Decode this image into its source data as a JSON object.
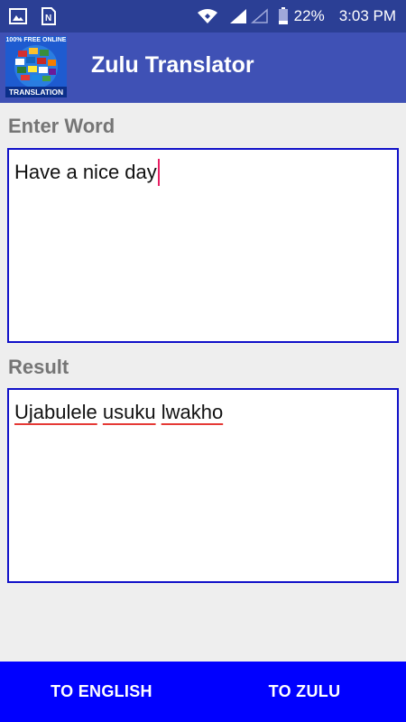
{
  "status_bar": {
    "left_icons": [
      "image-icon",
      "sim-card-icon"
    ],
    "right_icons": [
      "wifi-icon",
      "signal-icon",
      "signal-empty-icon",
      "battery-icon"
    ],
    "battery_percent": "22%",
    "time": "3:03 PM"
  },
  "app_bar": {
    "logo_top_text": "100% FREE ONLINE",
    "logo_bottom_text": "TRANSLATION",
    "title": "Zulu Translator"
  },
  "input_section": {
    "label": "Enter Word",
    "value": "Have a nice day"
  },
  "result_section": {
    "label": "Result",
    "words": [
      "Ujabulele",
      "usuku",
      "lwakho"
    ]
  },
  "bottom_bar": {
    "to_english_label": "TO ENGLISH",
    "to_zulu_label": "TO ZULU"
  },
  "colors": {
    "status_bar": "#2b3f95",
    "app_bar": "#3f51b5",
    "box_border": "#1010c8",
    "bottom_bar": "#0000ff",
    "caret": "#e91e63",
    "spell_underline": "#e53935"
  }
}
